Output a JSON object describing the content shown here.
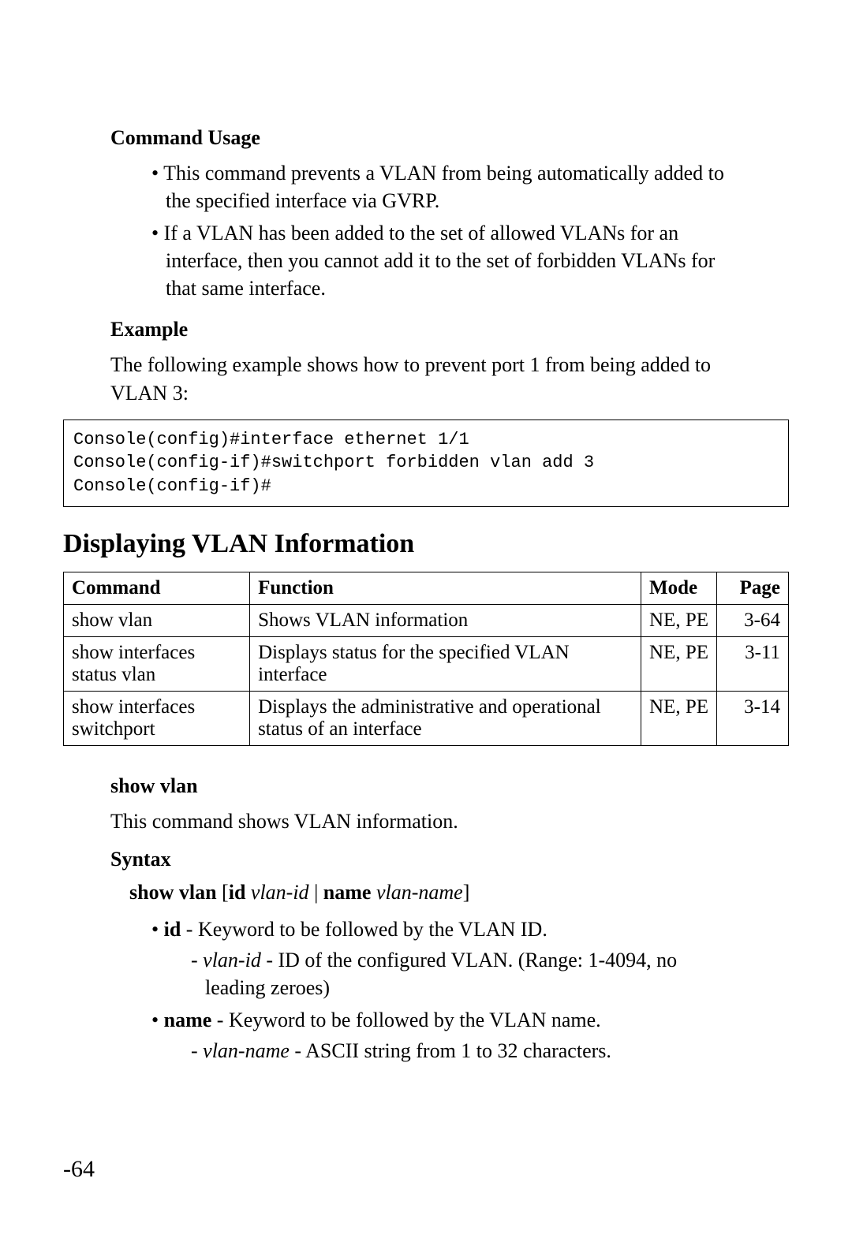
{
  "headings": {
    "command_usage": "Command Usage",
    "example": "Example",
    "section": "Displaying VLAN Information",
    "show_vlan": "show vlan",
    "syntax": "Syntax"
  },
  "usage_bullets": [
    "This command prevents a VLAN from being automatically added to the specified interface via GVRP.",
    "If a VLAN has been added to the set of allowed VLANs for an interface, then you cannot add it to the set of forbidden VLANs for that same interface."
  ],
  "example_intro": "The following example shows how to prevent port 1 from being added to VLAN 3:",
  "code_block": "Console(config)#interface ethernet 1/1\nConsole(config-if)#switchport forbidden vlan add 3\nConsole(config-if)#",
  "table": {
    "headers": {
      "command": "Command",
      "function": "Function",
      "mode": "Mode",
      "page": "Page"
    },
    "rows": [
      {
        "command": "show vlan",
        "function": "Shows VLAN information",
        "mode": "NE, PE",
        "page": "3-64"
      },
      {
        "command": "show interfaces status vlan",
        "function": "Displays status for the specified VLAN interface",
        "mode": "NE, PE",
        "page": "3-11"
      },
      {
        "command": "show interfaces switchport",
        "function": "Displays the administrative and operational status of an interface",
        "mode": "NE, PE",
        "page": "3-14"
      }
    ]
  },
  "show_vlan_desc": "This command shows VLAN information.",
  "syntax_line": {
    "prefix": "show vlan",
    "open": "[",
    "kw1": "id",
    "arg1": "vlan-id",
    "sep": "|",
    "kw2": "name",
    "arg2": "vlan-name",
    "close": "]"
  },
  "syntax_bullets": {
    "id_bold": "id",
    "id_rest": " - Keyword to be followed by the VLAN ID.",
    "id_sub_arg": "vlan-id",
    "id_sub_rest": " - ID of the configured VLAN. (Range: 1-4094, no leading zeroes)",
    "name_bold": "name",
    "name_rest": " - Keyword to be followed by the VLAN name.",
    "name_sub_arg": "vlan-name",
    "name_sub_rest": " - ASCII string from 1 to 32 characters."
  },
  "footer_page": "-64"
}
